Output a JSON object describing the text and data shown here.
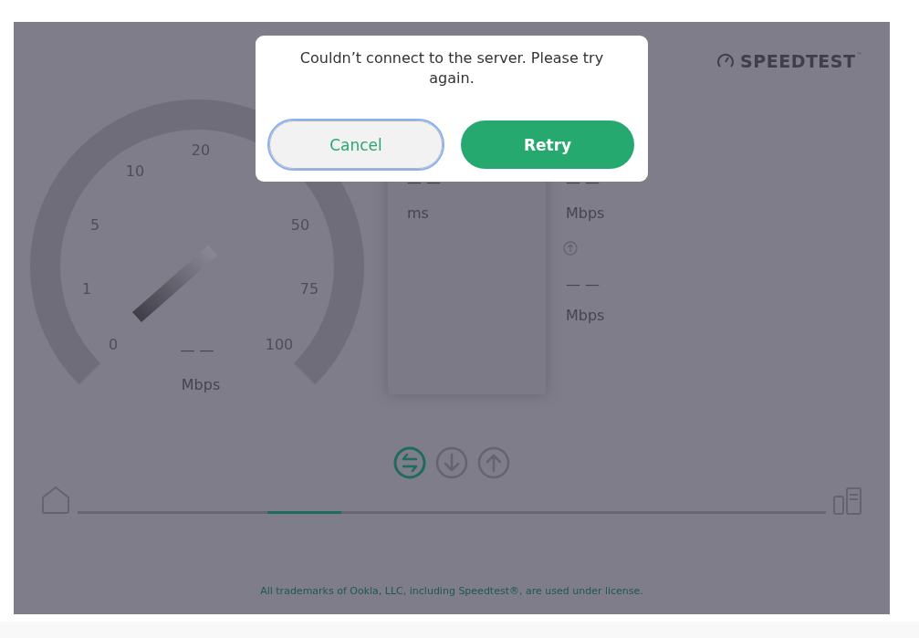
{
  "logo": {
    "text": "SPEEDTEST",
    "trademark": "™"
  },
  "gauge": {
    "ticks": [
      "0",
      "1",
      "5",
      "10",
      "20",
      "50",
      "75",
      "100"
    ],
    "reading": "— —",
    "unit": "Mbps"
  },
  "ping": {
    "reading": "— —",
    "unit": "ms"
  },
  "results": [
    {
      "kind": "download",
      "reading": "— —",
      "unit": "Mbps"
    },
    {
      "kind": "upload",
      "reading": "— —",
      "unit": "Mbps"
    }
  ],
  "modes": [
    {
      "kind": "multi",
      "selected": true
    },
    {
      "kind": "download",
      "selected": false
    },
    {
      "kind": "upload",
      "selected": false
    }
  ],
  "footer": "All trademarks of Ookla, LLC, including Speedtest®, are used under license.",
  "dialog": {
    "message": "Couldn’t connect to the server. Please try again.",
    "buttons": [
      {
        "kind": "secondary",
        "label": "Cancel",
        "focused": true
      },
      {
        "kind": "primary",
        "label": "Retry",
        "focused": false
      }
    ]
  }
}
